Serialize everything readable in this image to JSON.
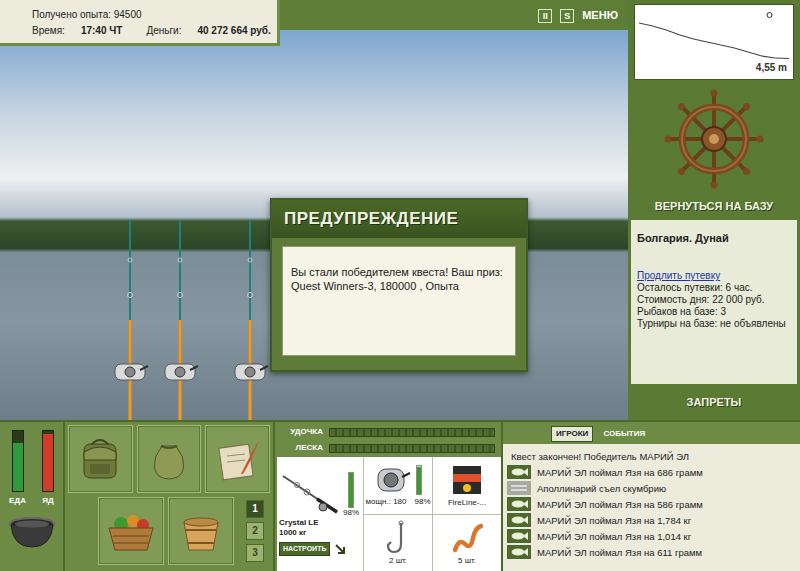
{
  "hud": {
    "experience": "Получено опыта: 94500",
    "time_label": "Время:",
    "time": "17:40 ЧТ",
    "money_label": "Деньги:",
    "money": "40 272 664 руб."
  },
  "toolbar": {
    "buttons": [
      {
        "label": "II",
        "kind": "box"
      },
      {
        "label": "S",
        "kind": "box"
      },
      {
        "label": "МЕНЮ",
        "kind": "text"
      }
    ]
  },
  "scene": {
    "rods": [
      {
        "bite": false
      },
      {
        "bite": false
      },
      {
        "bite": false
      }
    ]
  },
  "dialog": {
    "title": "ПРЕДУПРЕЖДЕНИЕ",
    "message": "Вы стали победителем квеста! Ваш приз: Quest Winners-3, 180000 , Опыта"
  },
  "depth_map": {
    "profile": [
      1.0,
      1.3,
      1.7,
      2.2,
      2.6,
      2.9,
      3.2,
      3.5,
      3.9,
      4.3,
      4.5,
      4.55
    ],
    "marker": {
      "level": 0.87
    },
    "reading": "4,55 m"
  },
  "base": {
    "action": "ВЕРНУТЬСЯ НА БАЗУ",
    "location": "Болгария. Дунай",
    "extend_link": "Продлить путевку",
    "facts": [
      "Осталось путевки: 6 час.",
      "Стоимость дня: 22 000 руб.",
      "Рыбаков на базе: 3",
      "Турниры на базе: не объявлены"
    ],
    "bans": "ЗАПРЕТЫ"
  },
  "meters": [
    {
      "label": "ЕДА",
      "level": 0.8,
      "color": "#2f9b3a"
    },
    {
      "label": "ЯД",
      "level": 0.95,
      "color": "#d23a2a"
    }
  ],
  "inventory": [
    {
      "kind": "backpack"
    },
    {
      "kind": "bag"
    },
    {
      "kind": "map"
    },
    {
      "kind": "food"
    },
    {
      "kind": "bucket"
    }
  ],
  "slots": [
    {
      "label": "1",
      "selected": true
    },
    {
      "label": "2",
      "selected": false
    },
    {
      "label": "3",
      "selected": false
    }
  ],
  "tension": [
    {
      "label": "УДОЧКА",
      "level": 0
    },
    {
      "label": "ЛЕСКА",
      "level": 0
    }
  ],
  "tackle": {
    "rod": {
      "name": "Crystal LE",
      "capacity": "1000 кг",
      "wear": "98%",
      "level": 0.98,
      "button": "НАСТРОИТЬ"
    },
    "reel": {
      "power": "мощн.: 180",
      "wear": "98%",
      "level": 0.98
    },
    "line": {
      "name": "FireLine-..."
    },
    "hook": {
      "count": "2 шт."
    },
    "bait": {
      "count": "5 шт."
    }
  },
  "chat": {
    "tabs": [
      {
        "label": "ИГРОКИ",
        "selected": true
      },
      {
        "label": "СОБЫТИЯ",
        "selected": false
      }
    ],
    "messages": [
      {
        "kind": "info",
        "text": "Квест закончен! Победитель МАРИЙ ЭЛ"
      },
      {
        "kind": "catch",
        "text": "МАРИЙ ЭЛ поймал Язя на 686 грамм"
      },
      {
        "kind": "eat",
        "text": "Аполлинарий съел скумбрию"
      },
      {
        "kind": "catch",
        "text": "МАРИЙ ЭЛ поймал Язя на 586 грамм"
      },
      {
        "kind": "catch",
        "text": "МАРИЙ ЭЛ поймал Язя на 1,784 кг"
      },
      {
        "kind": "catch",
        "text": "МАРИЙ ЭЛ поймал Язя на 1,014 кг"
      },
      {
        "kind": "catch",
        "text": "МАРИЙ ЭЛ поймал Язя на 611 грамм"
      }
    ]
  }
}
